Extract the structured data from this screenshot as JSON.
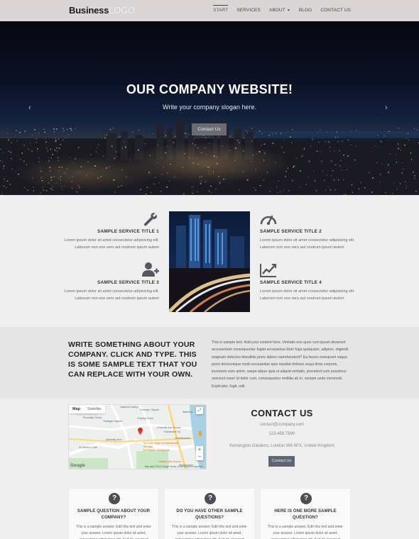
{
  "header": {
    "logo_bold": "Business",
    "logo_light": "LOGO",
    "nav": [
      {
        "label": "START",
        "active": true
      },
      {
        "label": "SERVICES"
      },
      {
        "label": "ABOUT"
      },
      {
        "label": "BLOG"
      },
      {
        "label": "CONTACT US"
      }
    ]
  },
  "hero": {
    "title": "OUR COMPANY WEBSITE!",
    "slogan": "Write your company slogan here.",
    "button": "Contact Us"
  },
  "services": [
    {
      "title": "SAMPLE SERVICE TITLE 1",
      "line1": "Lorem ipsum dolor sit amet consectetur adipisicing elit.",
      "line2": "Laborum non eos vero aut nostrum ipsum autem",
      "icon": "wrench-icon"
    },
    {
      "title": "SAMPLE SERVICE TITLE 2",
      "line1": "Lorem ipsum dolor sit amet consectetur adipisicing elit.",
      "line2": "Laborum non eos vero aut nostrum ipsum autem",
      "icon": "gauge-icon"
    },
    {
      "title": "SAMPLE SERVICE TITLE 3",
      "line1": "Lorem ipsum dolor sit amet consectetur adipisicing elit.",
      "line2": "Laborum non eos vero aut nostrum ipsum autem",
      "icon": "user-plus-icon"
    },
    {
      "title": "SAMPLE SERVICE TITLE 4",
      "line1": "Lorem ipsum dolor sit amet consectetur adipisicing elit.",
      "line2": "Laborum non eos vero aut nostrum ipsum autem",
      "icon": "line-chart-icon"
    }
  ],
  "about": {
    "heading": "WRITE SOMETHING ABOUT YOUR COMPANY. CLICK AND TYPE. THIS IS SOME SAMPLE TEXT THAT YOU CAN REPLACE WITH YOUR OWN.",
    "text": "This is sample text. Add your content here. Veritatis eos quos cum ipsum deserunt accusantium consequuntur fugiat accusamus illum fuga quisquam, adipisci, eligendi magnam delectus blanditiis porro labore reprehenderit? Ea facere numquam eaque porro doloremque modi recusandae quis repellat dolores sequi dicta corporis, inventore eum animi, saepe atque quia ut aliquid veritatis, provident cum possimus nesciunt esse! Id dolor cum, consequuntur mollitia ab in, veniam unde commodi. Explicabo, fugit, odit."
  },
  "map": {
    "tab_map": "Map",
    "tab_satellite": "Satellite",
    "google": "Google",
    "footer": "Map data ©2021 Google  Terms of Use  Report a map error",
    "labels": [
      "National Gallery",
      "Trafalgar Square",
      "Charing Cross",
      "Piccadilly Circus",
      "Leicester Square",
      "Westminster",
      "The Lord Mayor of Westminster",
      "The Mall",
      "The Royal Horseguards",
      "Cabinet War Rooms",
      "Admiralty Arch",
      "Waterloo",
      "Churchill War Rooms",
      "St James's Park",
      "Embankment",
      "Parliament Sq"
    ]
  },
  "contact": {
    "title": "CONTACT US",
    "email": "contact@company.com",
    "phone": "123.456.7890",
    "address": "Kensington Gardens, London W8 4PX, United Kingdom",
    "button": "Contact Us"
  },
  "faq": [
    {
      "title": "SAMPLE QUESTION ABOUT YOUR COMPANY?",
      "text": "This is a sample answer. Edit this text and enter your answer. Lorem ipsum dolor sit amet, consectetur adipisicing elit. Sed do eiusmod tempor."
    },
    {
      "title": "DO YOU HAVE OTHER SAMPLE QUESTIONS?",
      "text": "This is a sample answer. Edit this text and enter your answer. Lorem ipsum dolor sit amet, consectetur adipisicing elit. Sed do eiusmod tempor."
    },
    {
      "title": "HERE IS ONE MORE SAMPLE QUESTION?",
      "text": "This is a sample answer. Edit this text and enter your answer. Lorem ipsum dolor sit amet, consectetur adipisicing elit. Sed do eiusmod tempor."
    }
  ],
  "colors": {
    "header_bg": "#dcd5d5",
    "button_dark": "#5e6574",
    "icon_gray": "#4c4d55"
  }
}
